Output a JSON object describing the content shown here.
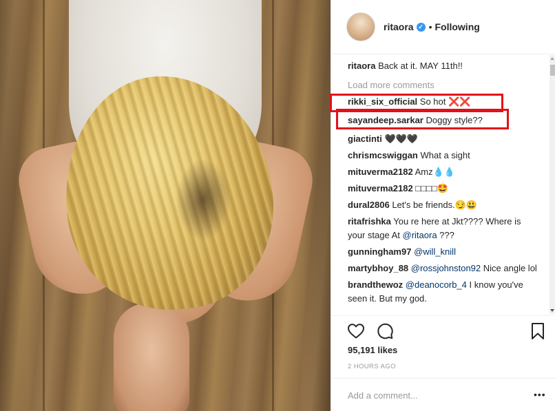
{
  "post": {
    "image_alt": "Photo of a blonde woman in a white top bending forward over a wooden floor",
    "username": "ritaora",
    "verified": true,
    "separator": "•",
    "follow_state": "Following"
  },
  "caption": {
    "user": "ritaora",
    "text": " Back at it. MAY 11th!!"
  },
  "load_more": "Load more comments",
  "comments": [
    {
      "user": "rikki_six_official",
      "text": " So hot ❌❌",
      "mention": "",
      "rest": ""
    },
    {
      "user": "sayandeep.sarkar",
      "text": " Doggy style??",
      "mention": "",
      "rest": ""
    },
    {
      "user": "giactinti",
      "text": " 🖤🖤🖤",
      "mention": "",
      "rest": ""
    },
    {
      "user": "chrismcswiggan",
      "text": " What a sight",
      "mention": "",
      "rest": ""
    },
    {
      "user": "mituverma2182",
      "text": " Amz💧💧",
      "mention": "",
      "rest": ""
    },
    {
      "user": "mituverma2182",
      "text": " □□□□🤩",
      "mention": "",
      "rest": ""
    },
    {
      "user": "dural2806",
      "text": " Let's be friends.😏😃",
      "mention": "",
      "rest": ""
    },
    {
      "user": "ritafrishka",
      "text": " You re here at Jkt???? Where is your stage At ",
      "mention": "@ritaora",
      "rest": " ???"
    },
    {
      "user": "gunningham97",
      "text": " ",
      "mention": "@will_knill",
      "rest": ""
    },
    {
      "user": "martybhoy_88",
      "text": " ",
      "mention": "@rossjohnston92",
      "rest": " Nice angle lol"
    },
    {
      "user": "brandthewoz",
      "text": " ",
      "mention": "@deanocorb_4",
      "rest": " I know you've seen it. But my god."
    }
  ],
  "icons": {
    "like": "heart-icon",
    "comment": "comment-bubble-icon",
    "save": "bookmark-icon",
    "more": "more-options-icon"
  },
  "likes": "95,191 likes",
  "timestamp": "2 HOURS AGO",
  "add_comment_placeholder": "Add a comment...",
  "more_glyph": "•••",
  "colors": {
    "highlight": "#e3101a",
    "verified": "#3897f0",
    "mention": "#003569",
    "muted": "#999999"
  }
}
